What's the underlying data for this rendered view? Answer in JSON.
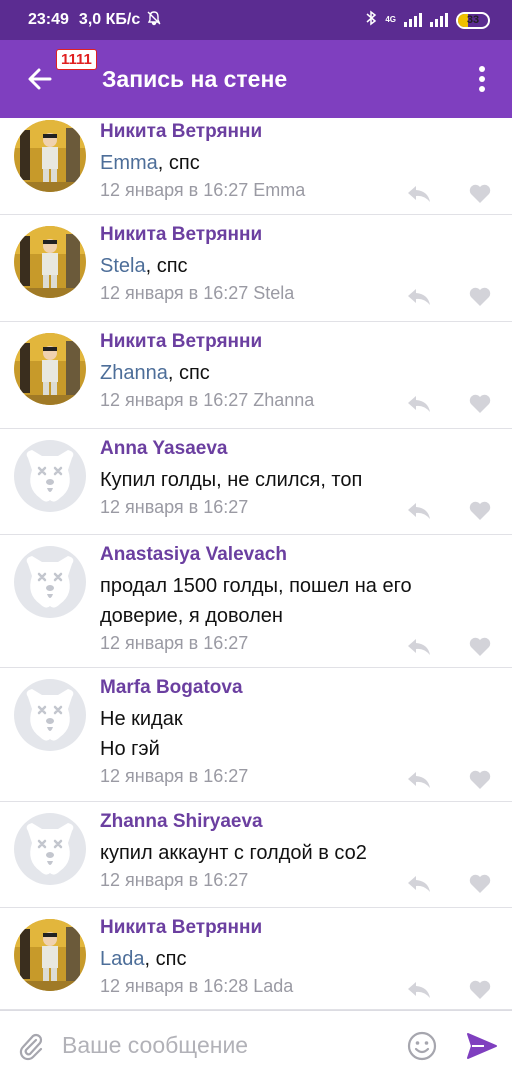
{
  "status": {
    "time": "23:49",
    "speed": "3,0 КБ/с",
    "battery": "33",
    "battery_level": 0.33,
    "network_label": "4G"
  },
  "appbar": {
    "badge": "1111",
    "title": "Запись на стене"
  },
  "comments": [
    {
      "author": "Никита Ветрянни",
      "mention": "Emma",
      "text": ", спс",
      "date": "12 января в 16:27",
      "reply_to": "Emma",
      "avatar": "photo"
    },
    {
      "author": "Никита Ветрянни",
      "mention": "Stela",
      "text": ", спс",
      "date": "12 января в 16:27",
      "reply_to": "Stela",
      "avatar": "photo"
    },
    {
      "author": "Никита Ветрянни",
      "mention": "Zhanna",
      "text": ", спс",
      "date": "12 января в 16:27",
      "reply_to": "Zhanna",
      "avatar": "photo"
    },
    {
      "author": "Anna Yasaeva",
      "mention": "",
      "text": "Купил голды, не слился, топ",
      "date": "12 января в 16:27",
      "reply_to": "",
      "avatar": "dog"
    },
    {
      "author": "Anastasiya Valevach",
      "mention": "",
      "text": "продал 1500 голды, пошел на его доверие, я доволен",
      "date": "12 января в 16:27",
      "reply_to": "",
      "avatar": "dog"
    },
    {
      "author": "Marfa Bogatova",
      "mention": "",
      "text": "Не кидак\nНо гэй",
      "date": "12 января в 16:27",
      "reply_to": "",
      "avatar": "dog"
    },
    {
      "author": "Zhanna Shiryaeva",
      "mention": "",
      "text": "купил аккаунт с голдой в со2",
      "date": "12 января в 16:27",
      "reply_to": "",
      "avatar": "dog"
    },
    {
      "author": "Никита Ветрянни",
      "mention": "Lada",
      "text": ", спс",
      "date": "12 января в 16:28",
      "reply_to": "Lada",
      "avatar": "photo"
    }
  ],
  "composer": {
    "placeholder": "Ваше сообщение",
    "value": ""
  },
  "icons": {
    "back": "arrow-left-icon",
    "menu": "more-vertical-icon",
    "reply": "reply-icon",
    "like": "heart-icon",
    "attach": "paperclip-icon",
    "emoji": "smiley-icon",
    "send": "send-icon"
  },
  "colors": {
    "status_bar": "#5b2c91",
    "app_bar": "#7f3fbf",
    "author": "#6b3fa0",
    "mention": "#4d6e99",
    "meta": "#9a9aa3",
    "send": "#7f3fbf"
  }
}
